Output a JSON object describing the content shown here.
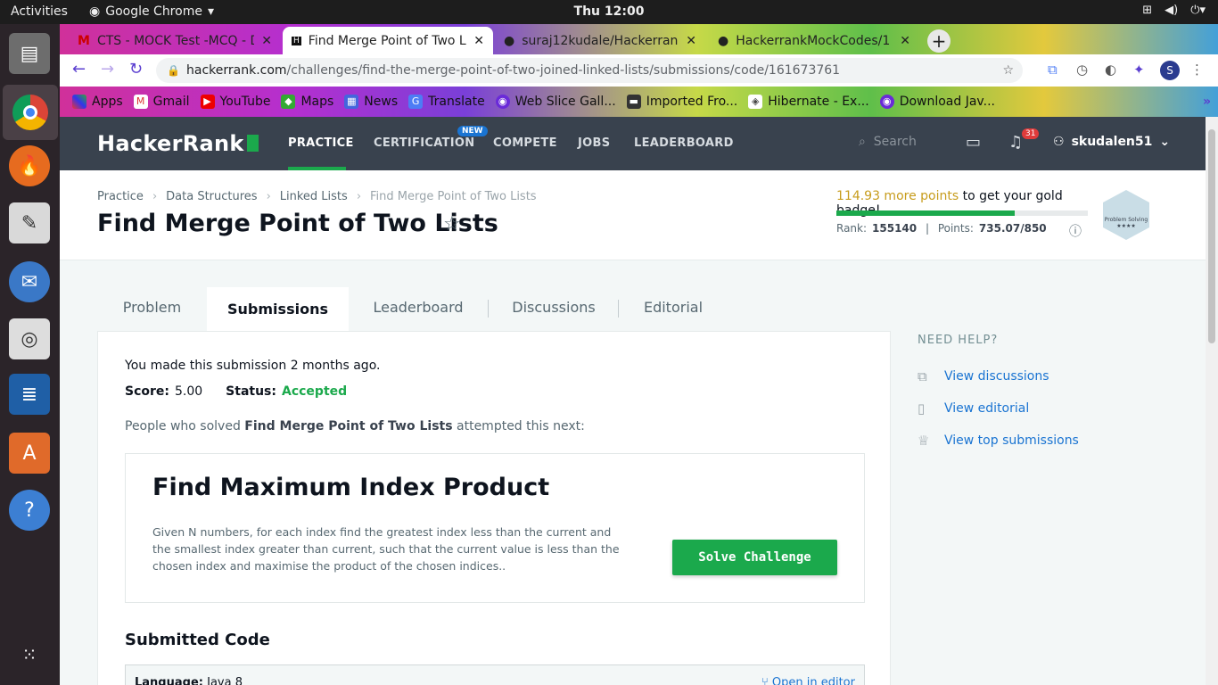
{
  "os": {
    "activities": "Activities",
    "app_name": "Google Chrome",
    "clock": "Thu 12:00"
  },
  "tabs": [
    {
      "title": "CTS - MOCK Test -MCQ - D",
      "active": false
    },
    {
      "title": "Find Merge Point of Two L",
      "active": true
    },
    {
      "title": "suraj12kudale/Hackerran",
      "active": false
    },
    {
      "title": "HackerrankMockCodes/1",
      "active": false
    }
  ],
  "address": {
    "domain": "hackerrank.com",
    "path": "/challenges/find-the-merge-point-of-two-joined-linked-lists/submissions/code/161673761",
    "profile": "S"
  },
  "bookmarks": [
    "Apps",
    "Gmail",
    "YouTube",
    "Maps",
    "News",
    "Translate",
    "Web Slice Gall...",
    "Imported Fro...",
    "Hibernate - Ex...",
    "Download Jav..."
  ],
  "nav": {
    "logo": "HackerRank",
    "items": [
      "PRACTICE",
      "CERTIFICATION",
      "COMPETE",
      "JOBS",
      "LEADERBOARD"
    ],
    "new_badge": "NEW",
    "search_placeholder": "Search",
    "notifications": "31",
    "username": "skudalen51"
  },
  "breadcrumb": [
    "Practice",
    "Data Structures",
    "Linked Lists",
    "Find Merge Point of Two Lists"
  ],
  "title": "Find Merge Point of Two Lists",
  "badge": {
    "points_needed": "114.93 more points",
    "suffix": " to get your gold badge!",
    "progress_percent": 71,
    "rank_label": "Rank:",
    "rank": "155140",
    "points_label": "Points:",
    "points": "735.07/850",
    "badge_name": "Problem Solving",
    "stars": "★★★★"
  },
  "page_tabs": [
    "Problem",
    "Submissions",
    "Leaderboard",
    "Discussions",
    "Editorial"
  ],
  "submission": {
    "made": "You made this submission 2 months ago.",
    "score_label": "Score:",
    "score": "5.00",
    "status_label": "Status:",
    "status": "Accepted",
    "people_prefix": "People who solved ",
    "people_challenge": "Find Merge Point of Two Lists",
    "people_suffix": " attempted this next:"
  },
  "next_challenge": {
    "title": "Find Maximum Index Product",
    "description": "Given N numbers, for each index find the greatest index less than the current and the smallest index greater than current, such that the current value is less than the chosen index and maximise the product of the chosen indices..",
    "button": "Solve Challenge"
  },
  "code": {
    "heading": "Submitted Code",
    "language_label": "Language:",
    "language": "Java 8",
    "open_editor": "Open in editor"
  },
  "help": {
    "heading": "NEED HELP?",
    "links": [
      "View discussions",
      "View editorial",
      "View top submissions"
    ]
  }
}
